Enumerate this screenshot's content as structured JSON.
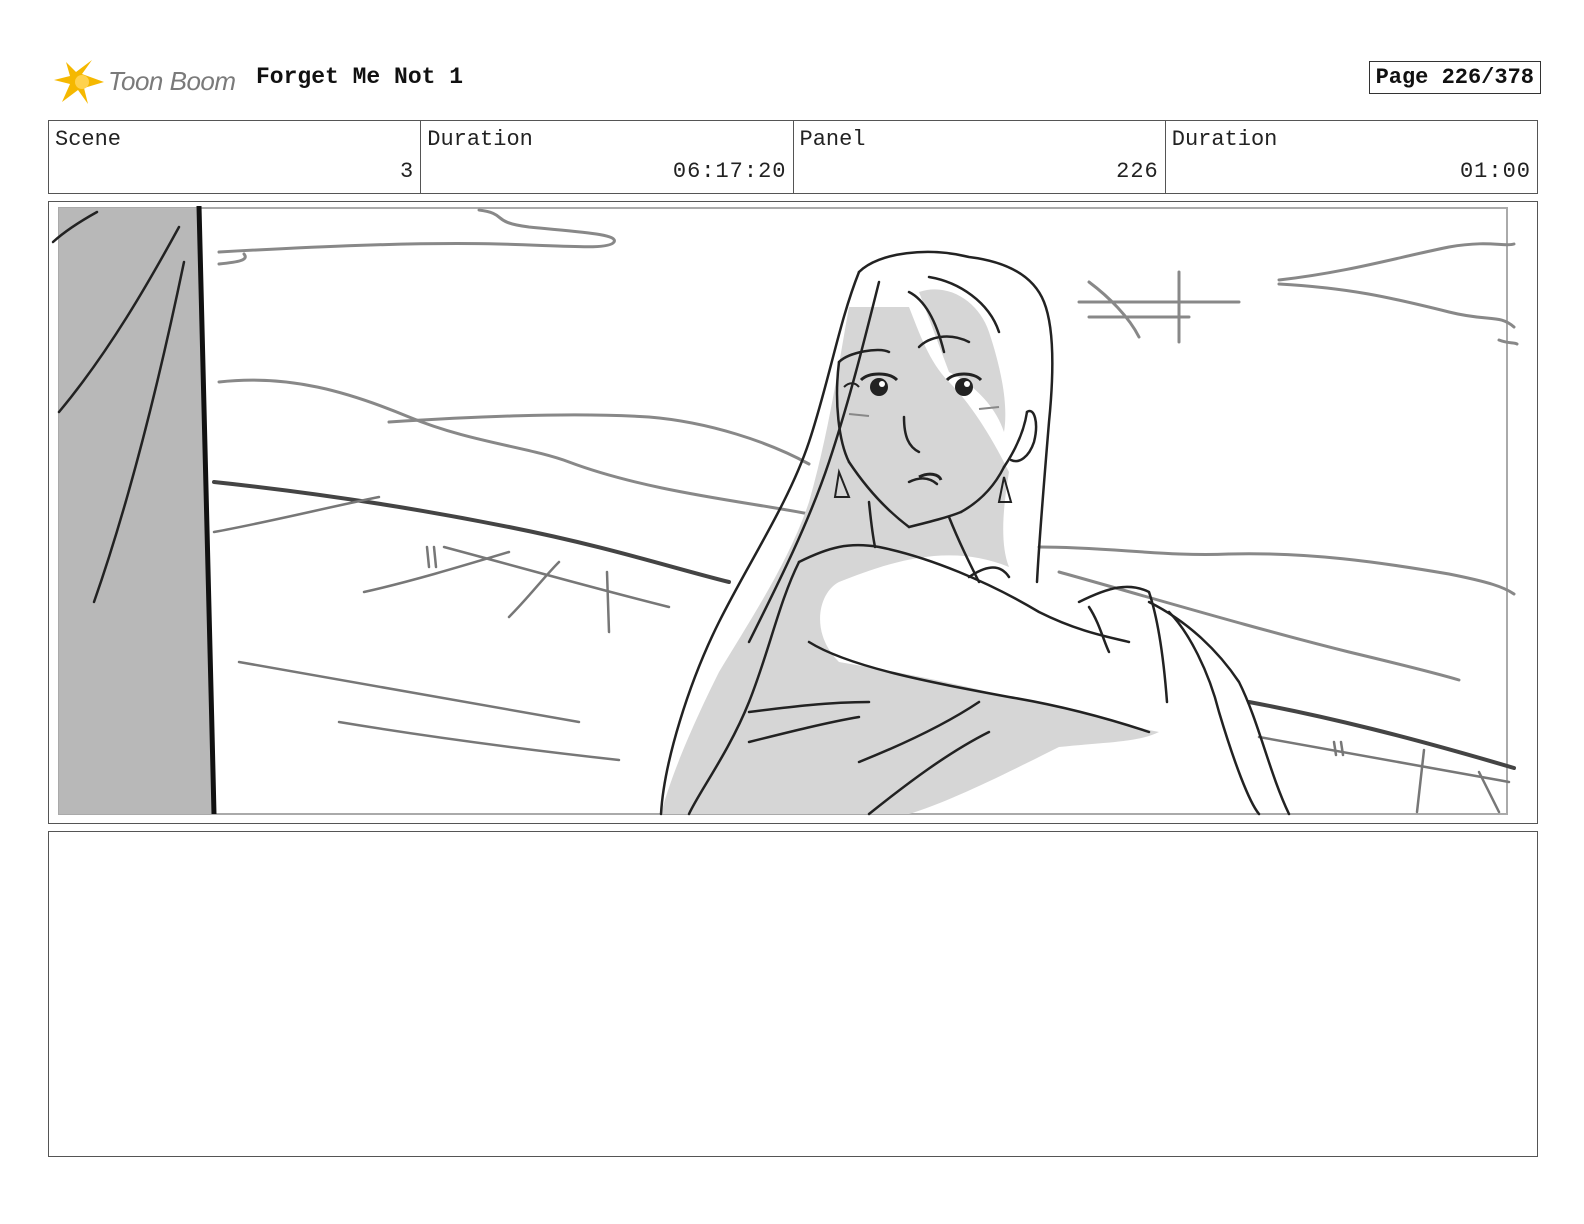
{
  "header": {
    "logo_text": "Toon Boom",
    "project_title": "Forget Me Not 1",
    "page_label": "Page 226/378"
  },
  "info": {
    "scene": {
      "label": "Scene",
      "value": "3"
    },
    "scene_duration": {
      "label": "Duration",
      "value": "06:17:20"
    },
    "panel": {
      "label": "Panel",
      "value": "226"
    },
    "panel_duration": {
      "label": "Duration",
      "value": "01:00"
    }
  },
  "colors": {
    "logo_star": "#f5b800",
    "logo_text": "#7a7a7a",
    "border": "#555555",
    "sketch_fill": "#d6d6d6",
    "pillar_fill": "#b8b8b8"
  },
  "icons": {
    "logo": "toon-boom-star-icon"
  }
}
